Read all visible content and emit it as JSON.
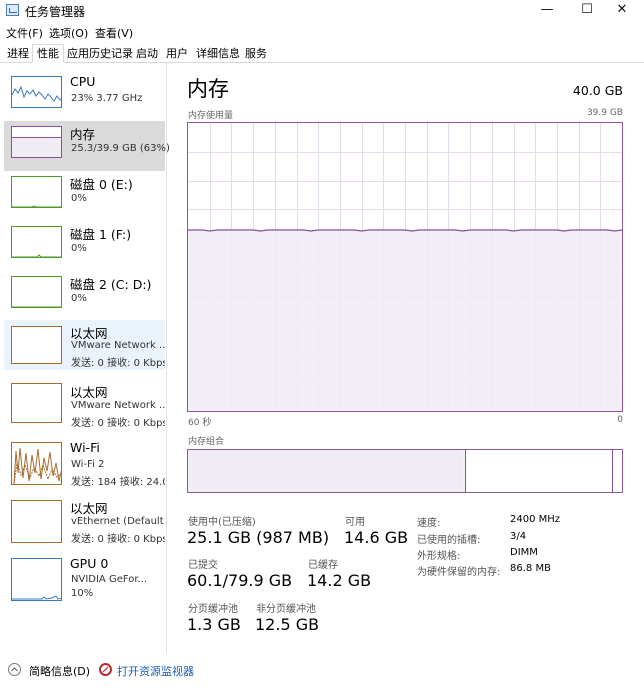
{
  "window": {
    "title": "任务管理器",
    "minimize": "—",
    "maximize": "☐",
    "close": "✕"
  },
  "menu": [
    "文件(F)",
    "选项(O)",
    "查看(V)"
  ],
  "tabs": [
    "进程",
    "性能",
    "应用历史记录",
    "启动",
    "用户",
    "详细信息",
    "服务"
  ],
  "active_tab": 1,
  "sidebar": {
    "items": [
      {
        "title": "CPU",
        "sub1": "23%  3.77 GHz",
        "color": "#3a7bbf"
      },
      {
        "title": "内存",
        "sub1": "25.3/39.9 GB (63%)",
        "color": "#8b4ea0",
        "fill": 0.63
      },
      {
        "title": "磁盘 0 (E:)",
        "sub1": "0%",
        "color": "#4d9a2a"
      },
      {
        "title": "磁盘 1 (F:)",
        "sub1": "0%",
        "color": "#4d9a2a"
      },
      {
        "title": "磁盘 2 (C: D:)",
        "sub1": "0%",
        "color": "#4d9a2a"
      },
      {
        "title": "以太网",
        "sub1": "VMware Network ...",
        "sub2": "发送: 0  接收: 0 Kbps",
        "color": "#a76a2a"
      },
      {
        "title": "以太网",
        "sub1": "VMware Network ...",
        "sub2": "发送: 0  接收: 0 Kbps",
        "color": "#a76a2a"
      },
      {
        "title": "Wi-Fi",
        "sub1": "Wi-Fi 2",
        "sub2": "发送: 184  接收: 24.0",
        "color": "#a76a2a"
      },
      {
        "title": "以太网",
        "sub1": "vEthernet (Default ...",
        "sub2": "发送: 0  接收: 0 Kbps",
        "color": "#a76a2a"
      },
      {
        "title": "GPU 0",
        "sub1": "NVIDIA GeFor...",
        "sub2": "10%",
        "color": "#3a7bbf"
      }
    ]
  },
  "main": {
    "heading": "内存",
    "total": "40.0 GB",
    "usage_label": "内存使用量",
    "usage_max": "39.9 GB",
    "usage_fraction": 0.63,
    "time_left": "60 秒",
    "time_right": "0",
    "composition_label": "内存组合",
    "stats": {
      "in_use_label": "使用中(已压缩)",
      "in_use_value": "25.1 GB (987 MB)",
      "available_label": "可用",
      "available_value": "14.6 GB",
      "committed_label": "已提交",
      "committed_value": "60.1/79.9 GB",
      "cached_label": "已缓存",
      "cached_value": "14.2 GB",
      "paged_label": "分页缓冲池",
      "paged_value": "1.3 GB",
      "nonpaged_label": "非分页缓冲池",
      "nonpaged_value": "12.5 GB"
    },
    "details": {
      "speed_label": "速度:",
      "speed_value": "2400 MHz",
      "slots_label": "已使用的插槽:",
      "slots_value": "3/4",
      "form_label": "外形规格:",
      "form_value": "DIMM",
      "reserved_label": "为硬件保留的内存:",
      "reserved_value": "86.8 MB"
    }
  },
  "footer": {
    "summary": "简略信息(D)",
    "monitor": "打开资源监视器"
  },
  "colors": {
    "memory": "#8b4ea0",
    "memory_fill": "#f1ebf4",
    "grid": "#e6dbea"
  }
}
